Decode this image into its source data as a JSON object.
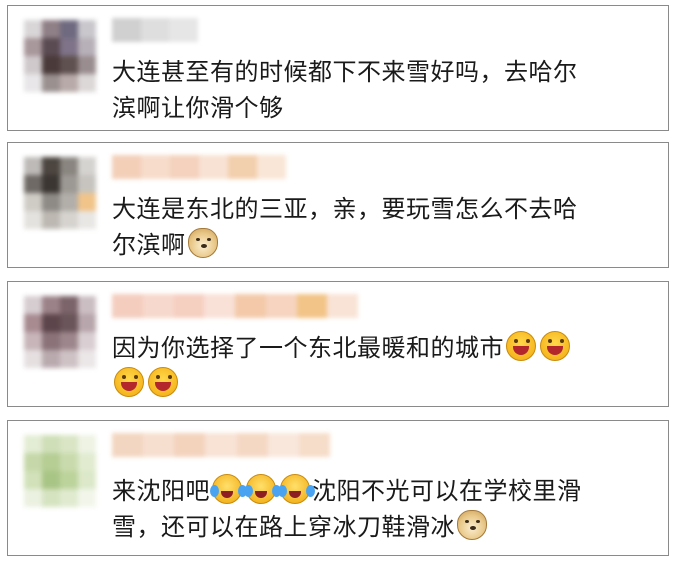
{
  "comments": [
    {
      "line1": "大连甚至有的时候都下不来雪好吗，去哈尔",
      "line2": "滨啊让你滑个够"
    },
    {
      "line1": "大连是东北的三亚，亲，要玩雪怎么不去哈",
      "line2": "尔滨啊",
      "line2_emoji": [
        "doge-icon"
      ]
    },
    {
      "line1": "因为你选择了一个东北最暖和的城市",
      "line1_emoji": [
        "laughing-icon",
        "laughing-icon"
      ],
      "line2_emoji": [
        "laughing-icon",
        "laughing-icon"
      ]
    },
    {
      "line1_a": "来沈阳吧",
      "line1_emoji": [
        "crying-laughing-icon",
        "crying-laughing-icon",
        "crying-laughing-icon"
      ],
      "line1_b": "沈阳不光可以在学校里滑",
      "line2": "雪，还可以在路上穿冰刀鞋滑冰",
      "line2_emoji": [
        "doge-icon"
      ]
    }
  ],
  "colors": {
    "card_border": "#8a8a8a",
    "text": "#1a1a1a"
  }
}
